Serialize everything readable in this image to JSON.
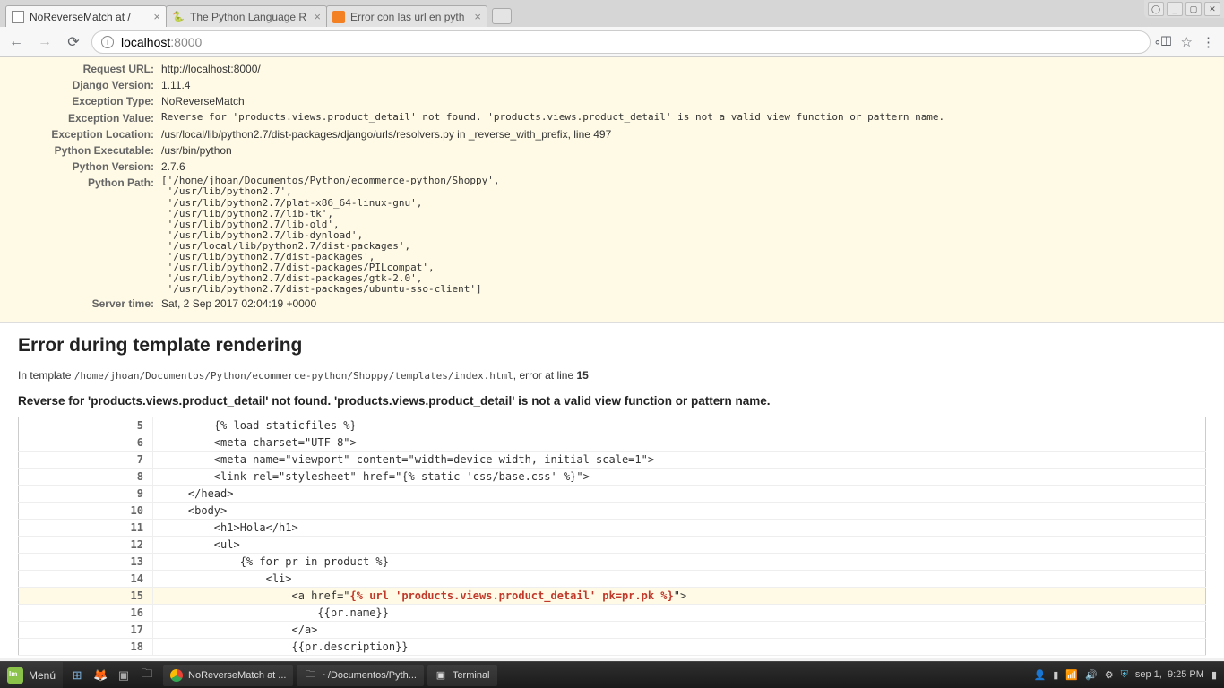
{
  "window_controls": {
    "min": "_",
    "max": "▢",
    "close": "✕",
    "user": "◯"
  },
  "tabs": [
    {
      "title": "NoReverseMatch at /",
      "active": true
    },
    {
      "title": "The Python Language R",
      "active": false
    },
    {
      "title": "Error con las url en pyth",
      "active": false
    }
  ],
  "url": {
    "host": "localhost",
    "port": ":8000"
  },
  "summary": {
    "request_url_label": "Request URL:",
    "request_url": "http://localhost:8000/",
    "django_version_label": "Django Version:",
    "django_version": "1.11.4",
    "exception_type_label": "Exception Type:",
    "exception_type": "NoReverseMatch",
    "exception_value_label": "Exception Value:",
    "exception_value": "Reverse for 'products.views.product_detail' not found. 'products.views.product_detail' is not a valid view function or pattern name.",
    "exception_location_label": "Exception Location:",
    "exception_location": "/usr/local/lib/python2.7/dist-packages/django/urls/resolvers.py in _reverse_with_prefix, line 497",
    "python_executable_label": "Python Executable:",
    "python_executable": "/usr/bin/python",
    "python_version_label": "Python Version:",
    "python_version": "2.7.6",
    "python_path_label": "Python Path:",
    "python_path": "['/home/jhoan/Documentos/Python/ecommerce-python/Shoppy',\n '/usr/lib/python2.7',\n '/usr/lib/python2.7/plat-x86_64-linux-gnu',\n '/usr/lib/python2.7/lib-tk',\n '/usr/lib/python2.7/lib-old',\n '/usr/lib/python2.7/lib-dynload',\n '/usr/local/lib/python2.7/dist-packages',\n '/usr/lib/python2.7/dist-packages',\n '/usr/lib/python2.7/dist-packages/PILcompat',\n '/usr/lib/python2.7/dist-packages/gtk-2.0',\n '/usr/lib/python2.7/dist-packages/ubuntu-sso-client']",
    "server_time_label": "Server time:",
    "server_time": "Sat, 2 Sep 2017 02:04:19 +0000"
  },
  "section": {
    "heading": "Error during template rendering",
    "in_template_prefix": "In template ",
    "template_path": "/home/jhoan/Documentos/Python/ecommerce-python/Shoppy/templates/index.html",
    "error_at_line_prefix": ", error at line ",
    "error_line_num": "15",
    "error_msg": "Reverse for 'products.views.product_detail' not found. 'products.views.product_detail' is not a valid view function or pattern name."
  },
  "code": {
    "5": "        {% load staticfiles %}",
    "6": "        <meta charset=\"UTF-8\">",
    "7": "        <meta name=\"viewport\" content=\"width=device-width, initial-scale=1\">",
    "8": "        <link rel=\"stylesheet\" href=\"{% static 'css/base.css' %}\">",
    "9": "    </head>",
    "10": "    <body>",
    "11": "        <h1>Hola</h1>",
    "12": "        <ul>",
    "13": "            {% for pr in product %}",
    "14": "                <li>",
    "15a": "                    <a href=\"",
    "15b": "{% url 'products.views.product_detail' pk=pr.pk %}",
    "15c": "\">",
    "16": "                        {{pr.name}}",
    "17": "                    </a>",
    "18": "                    {{pr.description}}"
  },
  "taskbar": {
    "menu": "Menú",
    "task1": "NoReverseMatch at ...",
    "task2": "~/Documentos/Pyth...",
    "task3": "Terminal",
    "date": "sep 1,",
    "time": "9:25 PM"
  }
}
